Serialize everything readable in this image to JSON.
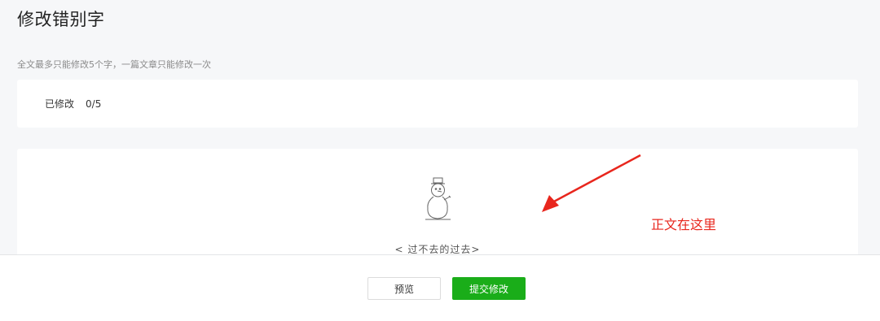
{
  "page": {
    "title": "修改错别字",
    "subtitle": "全文最多只能修改5个字，一篇文章只能修改一次"
  },
  "status": {
    "label": "已修改",
    "count": "0/5"
  },
  "content": {
    "article_title": "< 过不去的过去>",
    "illustration": "snowman-illustration"
  },
  "annotation": {
    "text": "正文在这里",
    "color": "#e8261d"
  },
  "footer": {
    "preview_label": "预览",
    "submit_label": "提交修改",
    "submit_color": "#1aad19"
  }
}
